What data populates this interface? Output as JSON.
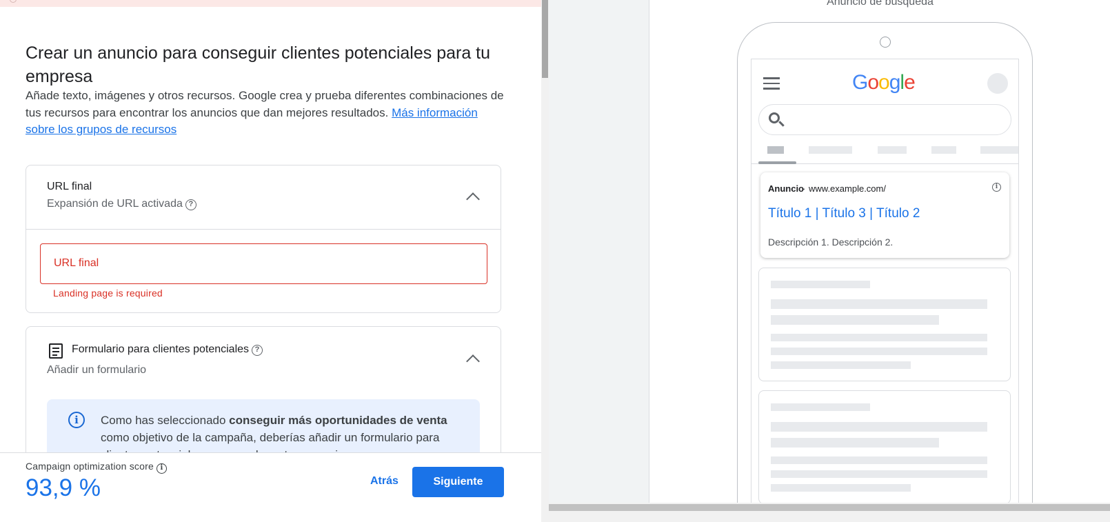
{
  "left": {
    "title": "Crear un anuncio para conseguir clientes potenciales para tu empresa",
    "description": "Añade texto, imágenes y otros recursos. Google crea y prueba diferentes combinaciones de tus recursos para encontrar los anuncios que dan mejores resultados.",
    "learn_more_link": "Más información sobre los grupos de recursos",
    "url_card": {
      "title": "URL final",
      "subtitle": "Expansión de URL activada",
      "input_placeholder": "URL final",
      "error": "Landing page is required"
    },
    "form_card": {
      "title": "Formulario para clientes potenciales",
      "subtitle": "Añadir un formulario",
      "info_prefix": "Como has seleccionado ",
      "info_bold": "conseguir más oportunidades de venta",
      "info_suffix": " como objetivo de la campaña, deberías añadir un formulario para clientes potenciales para usarlo en tus anuncios."
    },
    "footer": {
      "score_label": "Campaign optimization score",
      "score_value": "93,9 %",
      "back_label": "Atrás",
      "next_label": "Siguiente"
    }
  },
  "preview": {
    "label": "Anuncio de búsqueda",
    "ad": {
      "label": "Anuncio",
      "separator": "·",
      "url": "www.example.com/",
      "headline": "Título 1 | Título 3 | Título 2",
      "description": "Descripción 1. Descripción 2."
    }
  },
  "colors": {
    "accent": "#1a73e8",
    "error": "#d93025",
    "info_bg": "#e8f0fe"
  },
  "icons": [
    "help-icon",
    "chevron-up-icon",
    "form-icon",
    "info-icon",
    "menu-icon",
    "search-icon",
    "avatar"
  ]
}
